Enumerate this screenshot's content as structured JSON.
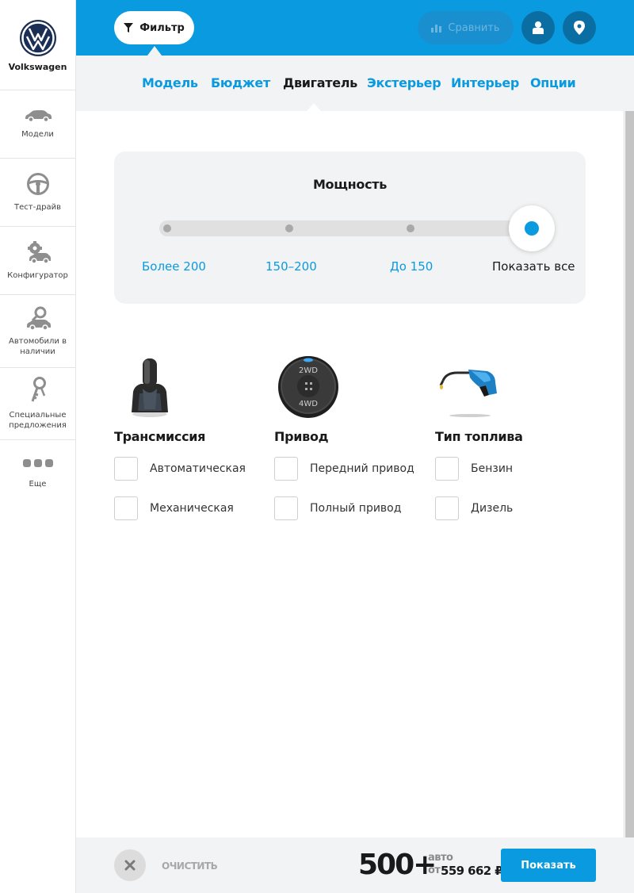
{
  "sidebar": {
    "brand": "Volkswagen",
    "items": [
      {
        "label": "Модели",
        "icon": "car-icon"
      },
      {
        "label": "Тест-драйв",
        "icon": "steering-wheel-icon"
      },
      {
        "label": "Конфигуратор",
        "icon": "configurator-icon"
      },
      {
        "label": "Автомобили в наличии",
        "icon": "car-key-icon"
      },
      {
        "label": "Специальные предложения",
        "icon": "keys-icon"
      },
      {
        "label": "Еще",
        "icon": "more-dots-icon"
      }
    ]
  },
  "topbar": {
    "filter_label": "Фильтр",
    "compare_label": "Сравнить",
    "accent_color": "#0a9ae0"
  },
  "tabs": [
    {
      "label": "Модель",
      "active": false
    },
    {
      "label": "Бюджет",
      "active": false
    },
    {
      "label": "Двигатель",
      "active": true
    },
    {
      "label": "Экстерьер",
      "active": false
    },
    {
      "label": "Интерьер",
      "active": false
    },
    {
      "label": "Опции",
      "active": false
    }
  ],
  "power": {
    "title": "Мощность",
    "stops": [
      "Более 200",
      "150–200",
      "До 150",
      "Показать все"
    ],
    "selected": "Показать все"
  },
  "filters": [
    {
      "title": "Трансмиссия",
      "icon": "gear-shifter-icon",
      "options": [
        "Автоматическая",
        "Механическая"
      ]
    },
    {
      "title": "Привод",
      "icon": "drive-selector-icon",
      "options": [
        "Передний привод",
        "Полный привод"
      ],
      "dial_top": "2WD",
      "dial_bottom": "4WD"
    },
    {
      "title": "Тип топлива",
      "icon": "fuel-nozzle-icon",
      "options": [
        "Бензин",
        "Дизель"
      ]
    }
  ],
  "bottom": {
    "clear_label": "ОЧИСТИТЬ",
    "count": "500+",
    "auto_label": "авто",
    "from_label": "от",
    "price": "559 662 ₽",
    "show_label": "Показать"
  }
}
